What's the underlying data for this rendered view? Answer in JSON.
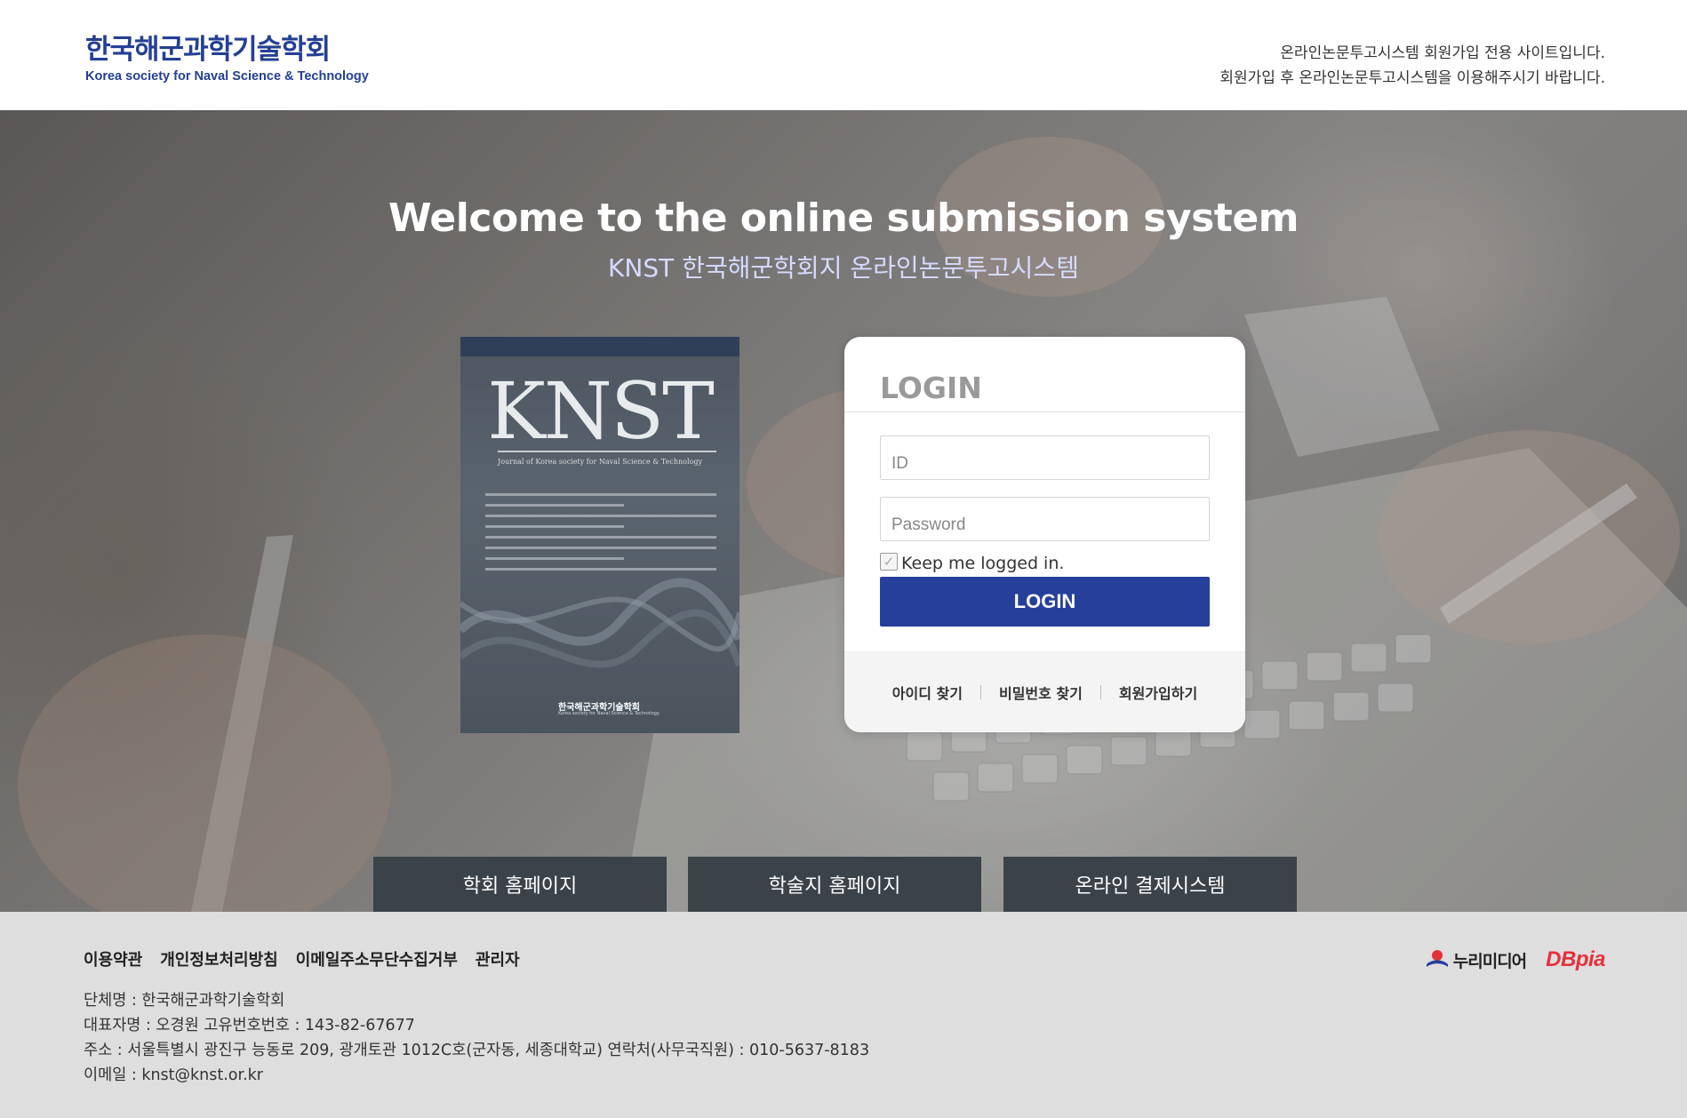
{
  "header": {
    "logo_ko": "한국해군과학기술학회",
    "logo_en": "Korea society for Naval Science & Technology",
    "notice_line1": "온라인논문투고시스템 회원가입 전용 사이트입니다.",
    "notice_line2": "회원가입 후 온라인논문투고시스템을 이용해주시기 바랍니다."
  },
  "hero": {
    "title": "Welcome to the online submission system",
    "subtitle": "KNST 한국해군학회지 온라인논문투고시스템"
  },
  "cover": {
    "title": "KNST",
    "subtitle": "Journal of Korea society for Naval Science & Technology",
    "publisher_ko": "한국해군과학기술학회",
    "publisher_en": "Korea society for Naval Science & Technology"
  },
  "login": {
    "heading": "LOGIN",
    "id_placeholder": "ID",
    "password_placeholder": "Password",
    "keep_logged_in_label": "Keep me logged in.",
    "keep_logged_in_checked": true,
    "submit_label": "LOGIN",
    "find_id_label": "아이디 찾기",
    "find_password_label": "비밀번호 찾기",
    "signup_label": "회원가입하기"
  },
  "quick_links": {
    "society_home": "학회 홈페이지",
    "journal_home": "학술지 홈페이지",
    "payment_system": "온라인 결제시스템"
  },
  "footer": {
    "nav": {
      "terms": "이용약관",
      "privacy": "개인정보처리방침",
      "email_refusal": "이메일주소무단수집거부",
      "admin": "관리자"
    },
    "info": {
      "org": "단체명 : 한국해군과학기술학회",
      "rep": "대표자명 : 오경원 고유번호번호 : 143-82-67677",
      "address": "주소 : 서울특별시 광진구 능동로 209, 광개토관 1012C호(군자동, 세종대학교) 연락처(사무국직원) : 010-5637-8183",
      "email": "이메일 : knst@knst.or.kr"
    },
    "logos": {
      "nurimedia": "누리미디어",
      "dbpia": "DBpia"
    }
  },
  "colors": {
    "brand_blue": "#243f95",
    "login_button": "#253f9a",
    "quick_link_bg": "#3c4348",
    "dbpia_red": "#e4313a"
  }
}
